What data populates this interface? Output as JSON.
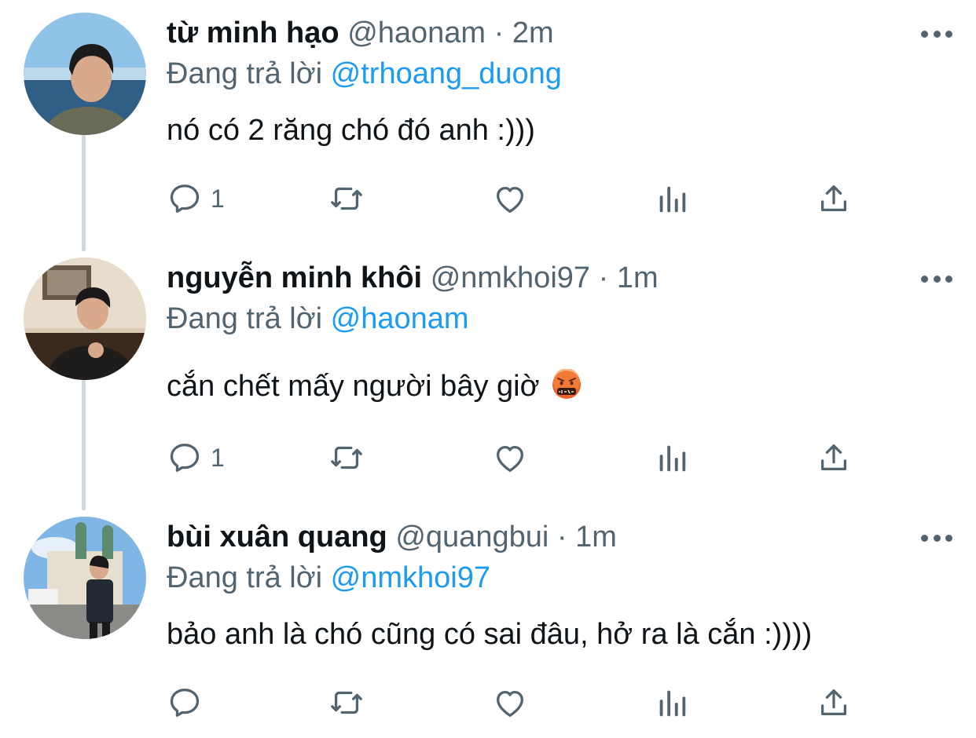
{
  "tweets": [
    {
      "name": "từ minh hạo",
      "handle": "@haonam",
      "separator": "·",
      "time": "2m",
      "reply_prefix": "Đang trả lời",
      "reply_to": "@trhoang_duong",
      "text": "nó có 2 răng chó đó anh :)))",
      "reply_count": "1",
      "avatar_icon": "avatar-photo"
    },
    {
      "name": "nguyễn minh khôi",
      "handle": "@nmkhoi97",
      "separator": "·",
      "time": "1m",
      "reply_prefix": "Đang trả lời",
      "reply_to": "@haonam",
      "text": "cắn chết mấy người bây giờ",
      "text_emoji": "face-with-symbols-on-mouth",
      "reply_count": "1",
      "avatar_icon": "avatar-photo"
    },
    {
      "name": "bùi xuân quang",
      "handle": "@quangbui",
      "separator": "·",
      "time": "1m",
      "reply_prefix": "Đang trả lời",
      "reply_to": "@nmkhoi97",
      "text": "bảo anh là chó cũng có sai đâu, hở ra là cắn :))))",
      "reply_count": "",
      "avatar_icon": "avatar-photo"
    }
  ],
  "colors": {
    "text": "#0f1419",
    "secondary": "#536471",
    "link": "#1d9bf0",
    "thread_line": "#cfd9de"
  },
  "action_icons": [
    "reply-icon",
    "retweet-icon",
    "like-icon",
    "views-icon",
    "share-icon"
  ]
}
